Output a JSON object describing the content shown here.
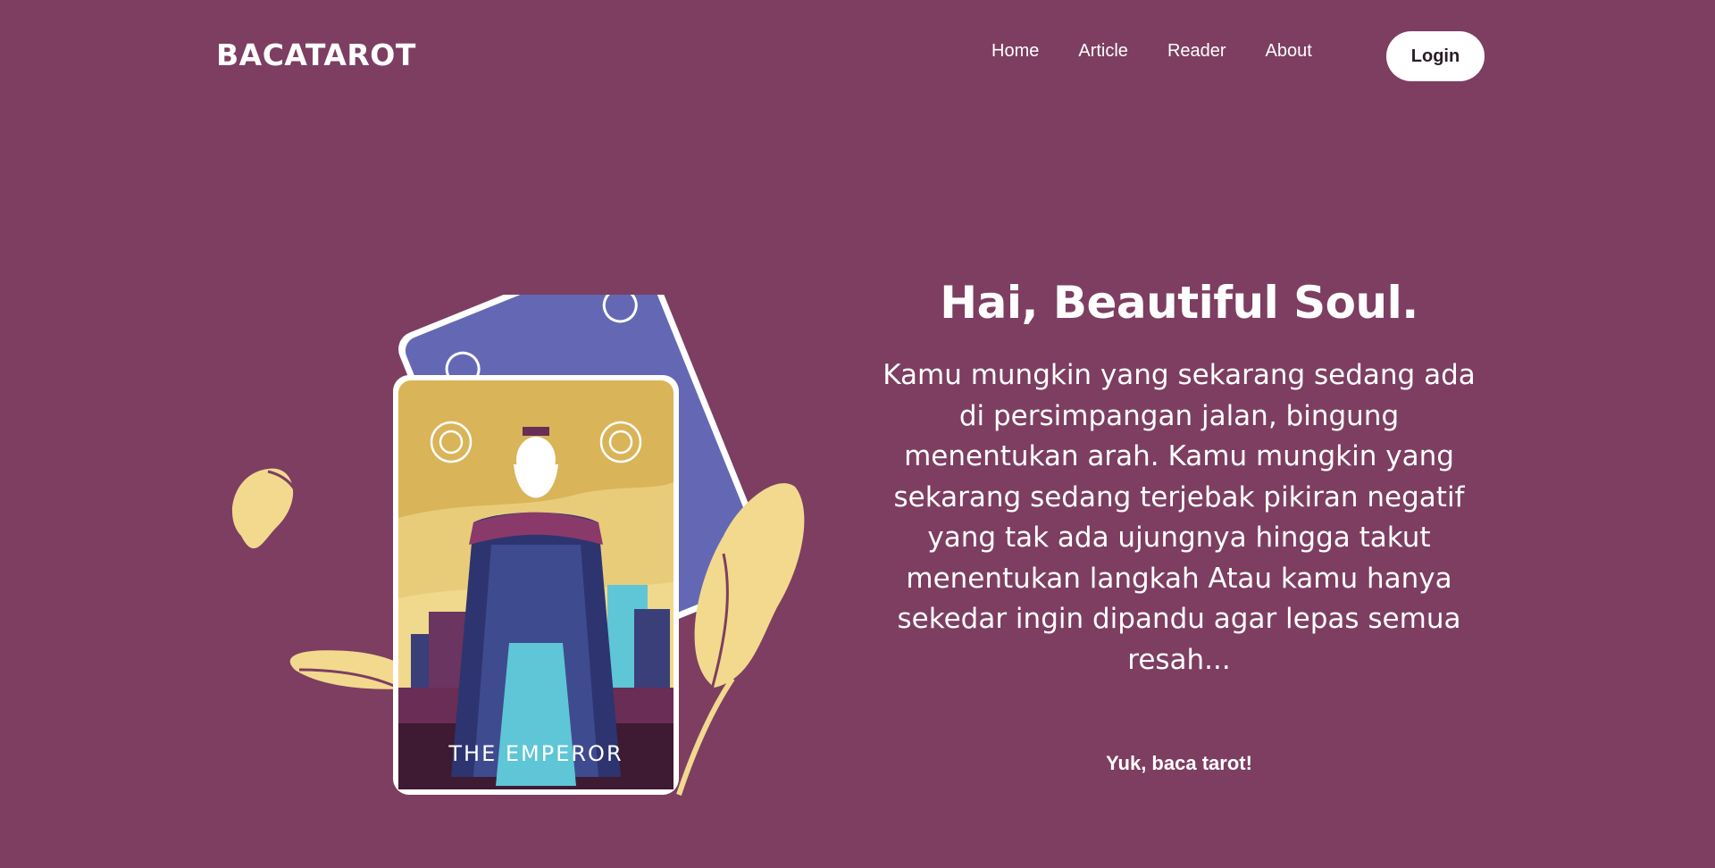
{
  "brand": {
    "name": "BACATAROT"
  },
  "nav": {
    "items": [
      {
        "label": "Home"
      },
      {
        "label": "Article"
      },
      {
        "label": "Reader"
      },
      {
        "label": "About"
      }
    ],
    "login_label": "Login"
  },
  "hero": {
    "title": "Hai, Beautiful Soul.",
    "description": "Kamu mungkin yang sekarang sedang ada di persimpangan jalan, bingung menentukan arah. Kamu mungkin yang sekarang sedang terjebak pikiran negatif yang tak ada ujungnya hingga takut menentukan langkah Atau kamu hanya sekedar ingin dipandu agar lepas semua resah...",
    "cta_label": "Yuk, baca tarot!",
    "card_caption": "THE EMPEROR"
  },
  "colors": {
    "background": "#7d3e61",
    "accent_gold": "#e6c36a",
    "leaf": "#f2d98e",
    "back_card": "#6468b4"
  }
}
